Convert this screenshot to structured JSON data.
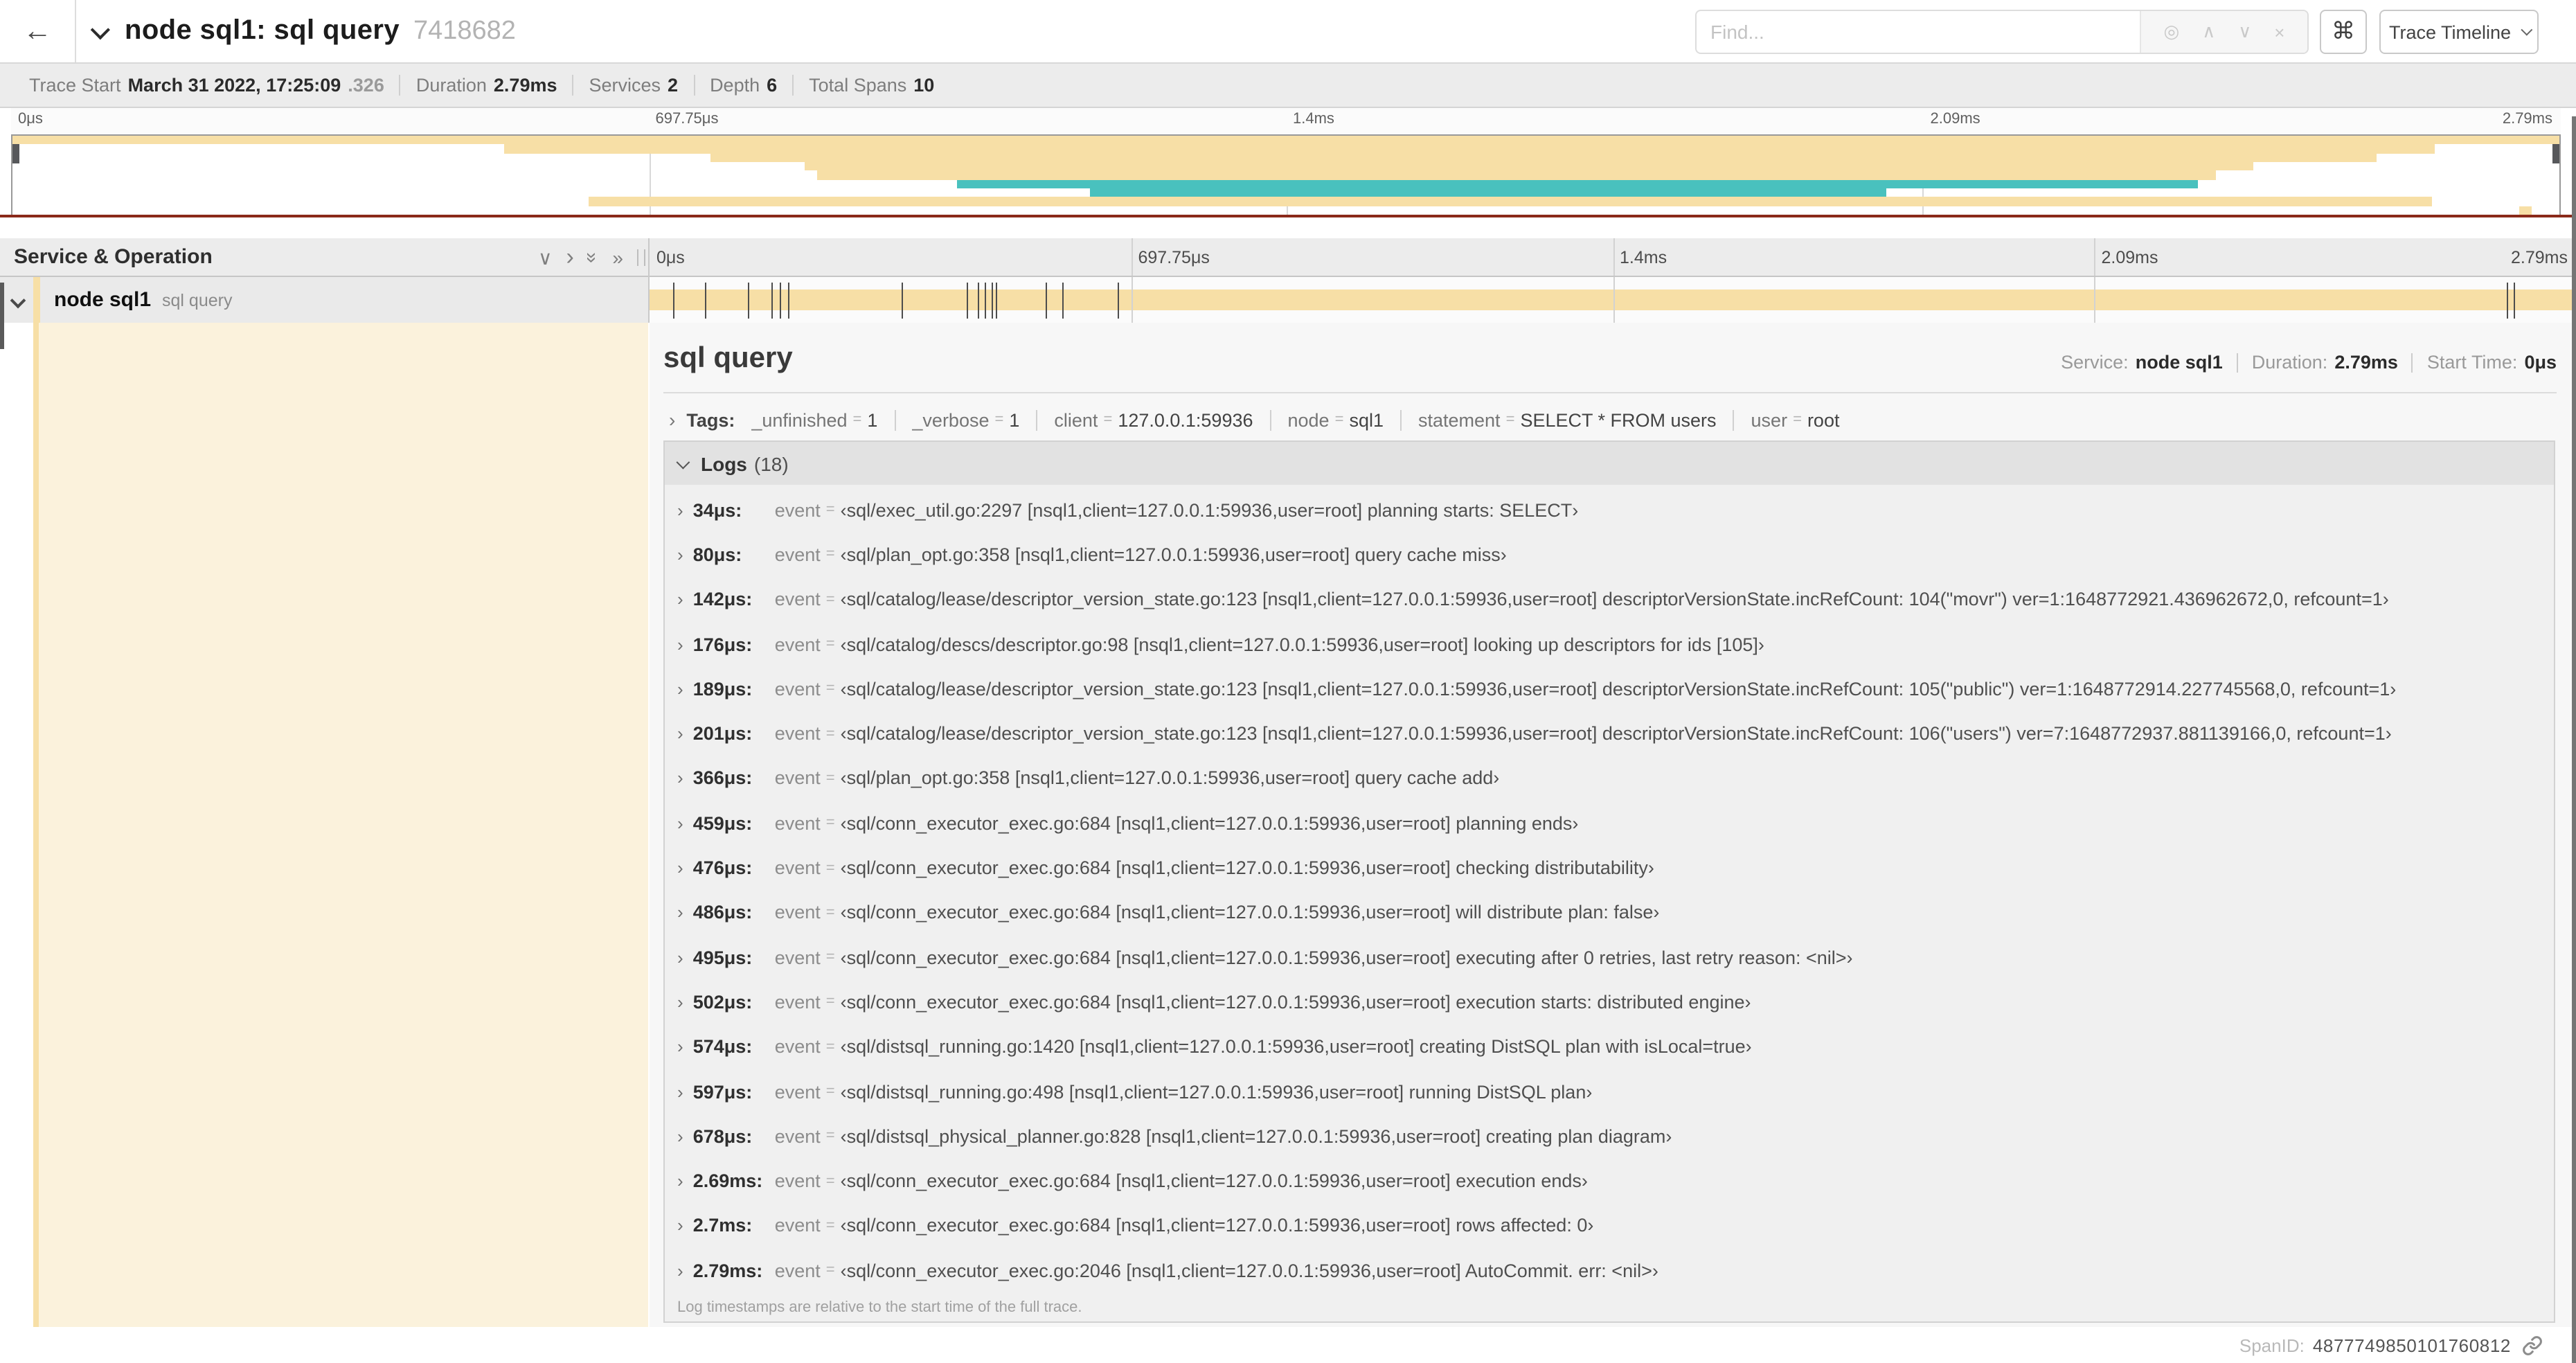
{
  "header": {
    "back_icon": "←",
    "title": "node sql1: sql query",
    "trace_id": "7418682",
    "find_placeholder": "Find...",
    "find_icons": {
      "locate": "◎",
      "prev": "∧",
      "next": "∨",
      "clear": "×"
    },
    "shortcut_icon": "⌘",
    "view_selector": "Trace Timeline"
  },
  "summary": {
    "items": [
      {
        "label": "Trace Start",
        "value": "March 31 2022, 17:25:09",
        "muted_suffix": ".326"
      },
      {
        "label": "Duration",
        "value": "2.79ms",
        "muted_suffix": ""
      },
      {
        "label": "Services",
        "value": "2",
        "muted_suffix": ""
      },
      {
        "label": "Depth",
        "value": "6",
        "muted_suffix": ""
      },
      {
        "label": "Total Spans",
        "value": "10",
        "muted_suffix": ""
      }
    ]
  },
  "colors": {
    "khaki": "#F7DFA6",
    "teal": "#49C1BE",
    "cream": "#FBF2DC",
    "marker": "#4d4d4d"
  },
  "minimap": {
    "spans": [
      {
        "start": 0,
        "end": 100,
        "color": "khaki"
      },
      {
        "start": 19.3,
        "end": 95.1,
        "color": "khaki"
      },
      {
        "start": 27.4,
        "end": 92.8,
        "color": "khaki"
      },
      {
        "start": 31.1,
        "end": 88.0,
        "color": "khaki"
      },
      {
        "start": 31.6,
        "end": 86.5,
        "color": "khaki"
      },
      {
        "start": 37.1,
        "end": 85.8,
        "color": "teal"
      },
      {
        "start": 42.3,
        "end": 73.6,
        "color": "teal"
      },
      {
        "start": 22.6,
        "end": 95.0,
        "color": "khaki"
      },
      {
        "start": 98.4,
        "end": 98.9,
        "color": "khaki"
      }
    ]
  },
  "timeline": {
    "left_header": "Service & Operation",
    "header_icons": {
      "collapse_one": "∨",
      "expand_one": "›",
      "collapse_all": "»",
      "expand_all": "»"
    },
    "ticks": [
      {
        "label": "0μs",
        "pos": 0
      },
      {
        "label": "697.75μs",
        "pos": 25
      },
      {
        "label": "1.4ms",
        "pos": 50
      },
      {
        "label": "2.09ms",
        "pos": 75
      },
      {
        "label": "2.79ms",
        "pos": 100
      }
    ],
    "gridline_pos": [
      25,
      50,
      75
    ],
    "row": {
      "service": "node sql1",
      "operation": "sql query"
    },
    "duration_us": 2790,
    "log_marker_us": [
      34,
      80,
      142,
      176,
      189,
      201,
      366,
      459,
      476,
      486,
      495,
      502,
      574,
      597,
      678,
      2690,
      2700,
      2790
    ]
  },
  "detail": {
    "title": "sql query",
    "meta": [
      {
        "label": "Service:",
        "value": "node sql1"
      },
      {
        "label": "Duration:",
        "value": "2.79ms"
      },
      {
        "label": "Start Time:",
        "value": "0μs"
      }
    ],
    "tags": {
      "label": "Tags:",
      "items": [
        {
          "key": "_unfinished",
          "value": "1"
        },
        {
          "key": "_verbose",
          "value": "1"
        },
        {
          "key": "client",
          "value": "127.0.0.1:59936"
        },
        {
          "key": "node",
          "value": "sql1"
        },
        {
          "key": "statement",
          "value": "SELECT * FROM users"
        },
        {
          "key": "user",
          "value": "root"
        }
      ]
    },
    "logs": {
      "title": "Logs",
      "count": "(18)",
      "field": "event",
      "entries": [
        {
          "time": "34μs:",
          "value": "‹sql/exec_util.go:2297 [nsql1,client=127.0.0.1:59936,user=root] planning starts: SELECT›"
        },
        {
          "time": "80μs:",
          "value": "‹sql/plan_opt.go:358 [nsql1,client=127.0.0.1:59936,user=root] query cache miss›"
        },
        {
          "time": "142μs:",
          "value": "‹sql/catalog/lease/descriptor_version_state.go:123 [nsql1,client=127.0.0.1:59936,user=root] descriptorVersionState.incRefCount: 104(\"movr\") ver=1:1648772921.436962672,0, refcount=1›"
        },
        {
          "time": "176μs:",
          "value": "‹sql/catalog/descs/descriptor.go:98 [nsql1,client=127.0.0.1:59936,user=root] looking up descriptors for ids [105]›"
        },
        {
          "time": "189μs:",
          "value": "‹sql/catalog/lease/descriptor_version_state.go:123 [nsql1,client=127.0.0.1:59936,user=root] descriptorVersionState.incRefCount: 105(\"public\") ver=1:1648772914.227745568,0, refcount=1›"
        },
        {
          "time": "201μs:",
          "value": "‹sql/catalog/lease/descriptor_version_state.go:123 [nsql1,client=127.0.0.1:59936,user=root] descriptorVersionState.incRefCount: 106(\"users\") ver=7:1648772937.881139166,0, refcount=1›"
        },
        {
          "time": "366μs:",
          "value": "‹sql/plan_opt.go:358 [nsql1,client=127.0.0.1:59936,user=root] query cache add›"
        },
        {
          "time": "459μs:",
          "value": "‹sql/conn_executor_exec.go:684 [nsql1,client=127.0.0.1:59936,user=root] planning ends›"
        },
        {
          "time": "476μs:",
          "value": "‹sql/conn_executor_exec.go:684 [nsql1,client=127.0.0.1:59936,user=root] checking distributability›"
        },
        {
          "time": "486μs:",
          "value": "‹sql/conn_executor_exec.go:684 [nsql1,client=127.0.0.1:59936,user=root] will distribute plan: false›"
        },
        {
          "time": "495μs:",
          "value": "‹sql/conn_executor_exec.go:684 [nsql1,client=127.0.0.1:59936,user=root] executing after 0 retries, last retry reason: <nil>›"
        },
        {
          "time": "502μs:",
          "value": "‹sql/conn_executor_exec.go:684 [nsql1,client=127.0.0.1:59936,user=root] execution starts: distributed engine›"
        },
        {
          "time": "574μs:",
          "value": "‹sql/distsql_running.go:1420 [nsql1,client=127.0.0.1:59936,user=root] creating DistSQL plan with isLocal=true›"
        },
        {
          "time": "597μs:",
          "value": "‹sql/distsql_running.go:498 [nsql1,client=127.0.0.1:59936,user=root] running DistSQL plan›"
        },
        {
          "time": "678μs:",
          "value": "‹sql/distsql_physical_planner.go:828 [nsql1,client=127.0.0.1:59936,user=root] creating plan diagram›"
        },
        {
          "time": "2.69ms:",
          "value": "‹sql/conn_executor_exec.go:684 [nsql1,client=127.0.0.1:59936,user=root] execution ends›"
        },
        {
          "time": "2.7ms:",
          "value": "‹sql/conn_executor_exec.go:684 [nsql1,client=127.0.0.1:59936,user=root] rows affected: 0›"
        },
        {
          "time": "2.79ms:",
          "value": "‹sql/conn_executor_exec.go:2046 [nsql1,client=127.0.0.1:59936,user=root] AutoCommit. err: <nil>›"
        }
      ],
      "footer": "Log timestamps are relative to the start time of the full trace."
    },
    "span_id": {
      "label": "SpanID:",
      "value": "4877749850101760812"
    }
  }
}
